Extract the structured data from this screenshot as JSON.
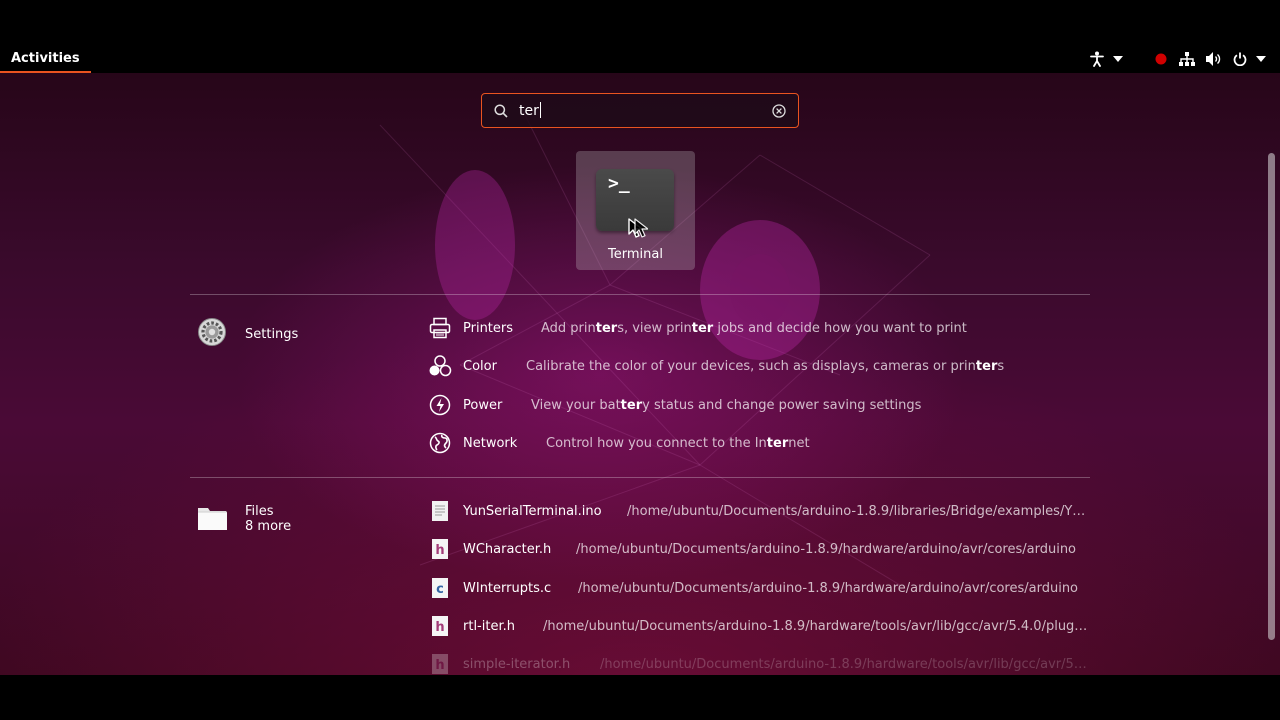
{
  "topbar": {
    "activities_label": "Activities",
    "tray_icons": [
      "accessibility-icon",
      "chevron-down-icon",
      "recording-indicator-icon",
      "network-icon",
      "volume-icon",
      "power-icon",
      "chevron-down-icon"
    ]
  },
  "search": {
    "value": "ter",
    "icon": "search-icon",
    "clear_icon": "clear-icon"
  },
  "apps": [
    {
      "label": "Terminal",
      "icon": "terminal-icon"
    }
  ],
  "settings_provider": {
    "label": "Settings",
    "icon": "settings-gear-icon",
    "results": [
      {
        "title": "Printers",
        "icon": "printer-icon",
        "desc_parts": [
          "Add prin",
          "ter",
          "s, view prin",
          "ter",
          " jobs and decide how you want to print"
        ]
      },
      {
        "title": "Color",
        "icon": "color-icon",
        "desc_parts": [
          "Calibrate the color of your devices, such as displays, cameras or prin",
          "ter",
          "s",
          "",
          ""
        ]
      },
      {
        "title": "Power",
        "icon": "power-settings-icon",
        "desc_parts": [
          "View your bat",
          "ter",
          "y status and change power saving settings",
          "",
          ""
        ]
      },
      {
        "title": "Network",
        "icon": "globe-icon",
        "desc_parts": [
          "Control how you connect to the In",
          "ter",
          "net",
          "",
          ""
        ]
      }
    ]
  },
  "files_provider": {
    "label": "Files",
    "more": "8 more",
    "icon": "folder-icon",
    "results": [
      {
        "title": "YunSerialTerminal.ino",
        "icon": "text-file-icon",
        "path": "/home/ubuntu/Documents/arduino-1.8.9/libraries/Bridge/examples/Y…"
      },
      {
        "title": "WCharacter.h",
        "icon": "h-file-icon",
        "path": "/home/ubuntu/Documents/arduino-1.8.9/hardware/arduino/avr/cores/arduino"
      },
      {
        "title": "WInterrupts.c",
        "icon": "c-file-icon",
        "path": "/home/ubuntu/Documents/arduino-1.8.9/hardware/arduino/avr/cores/arduino"
      },
      {
        "title": "rtl-iter.h",
        "icon": "h-file-icon",
        "path": "/home/ubuntu/Documents/arduino-1.8.9/hardware/tools/avr/lib/gcc/avr/5.4.0/plug…"
      },
      {
        "title": "simple-iterator.h",
        "icon": "h-file-icon",
        "path": "/home/ubuntu/Documents/arduino-1.8.9/hardware/tools/avr/lib/gcc/avr/5…"
      }
    ]
  },
  "colors": {
    "accent": "#e95420",
    "c_file": "#3465a4",
    "h_file": "#a33c78"
  }
}
